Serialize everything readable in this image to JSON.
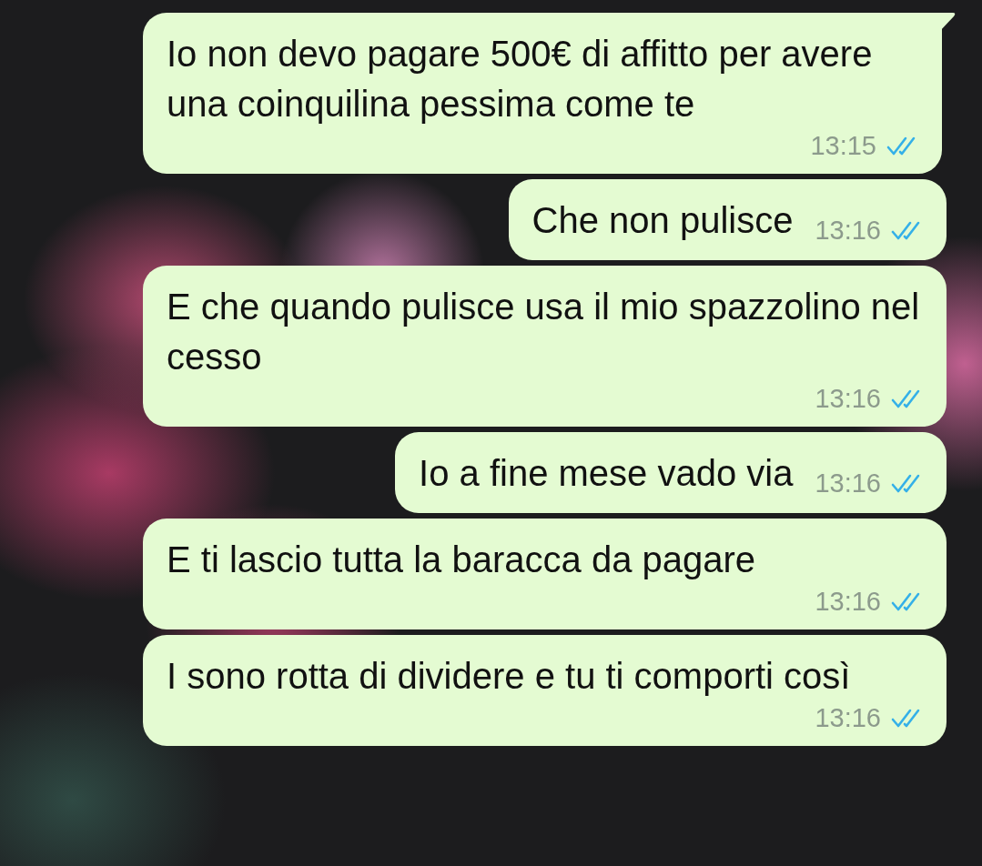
{
  "messages": [
    {
      "text": "Io non devo pagare 500€ di affitto per avere una coinquilina pessima come te",
      "time": "13:15",
      "read": true,
      "kind": "block",
      "tail": true
    },
    {
      "text": "Che non pulisce",
      "time": "13:16",
      "read": true,
      "kind": "inline",
      "tail": false
    },
    {
      "text": "E che quando pulisce usa il mio spazzolino nel cesso",
      "time": "13:16",
      "read": true,
      "kind": "block",
      "tail": false
    },
    {
      "text": "Io a fine mese vado via",
      "time": "13:16",
      "read": true,
      "kind": "inline",
      "tail": false
    },
    {
      "text": "E ti lascio tutta la baracca da pagare",
      "time": "13:16",
      "read": true,
      "kind": "block",
      "tail": false
    },
    {
      "text": "I sono rotta di dividere e tu ti comporti così",
      "time": "13:16",
      "read": true,
      "kind": "block",
      "tail": false
    }
  ]
}
